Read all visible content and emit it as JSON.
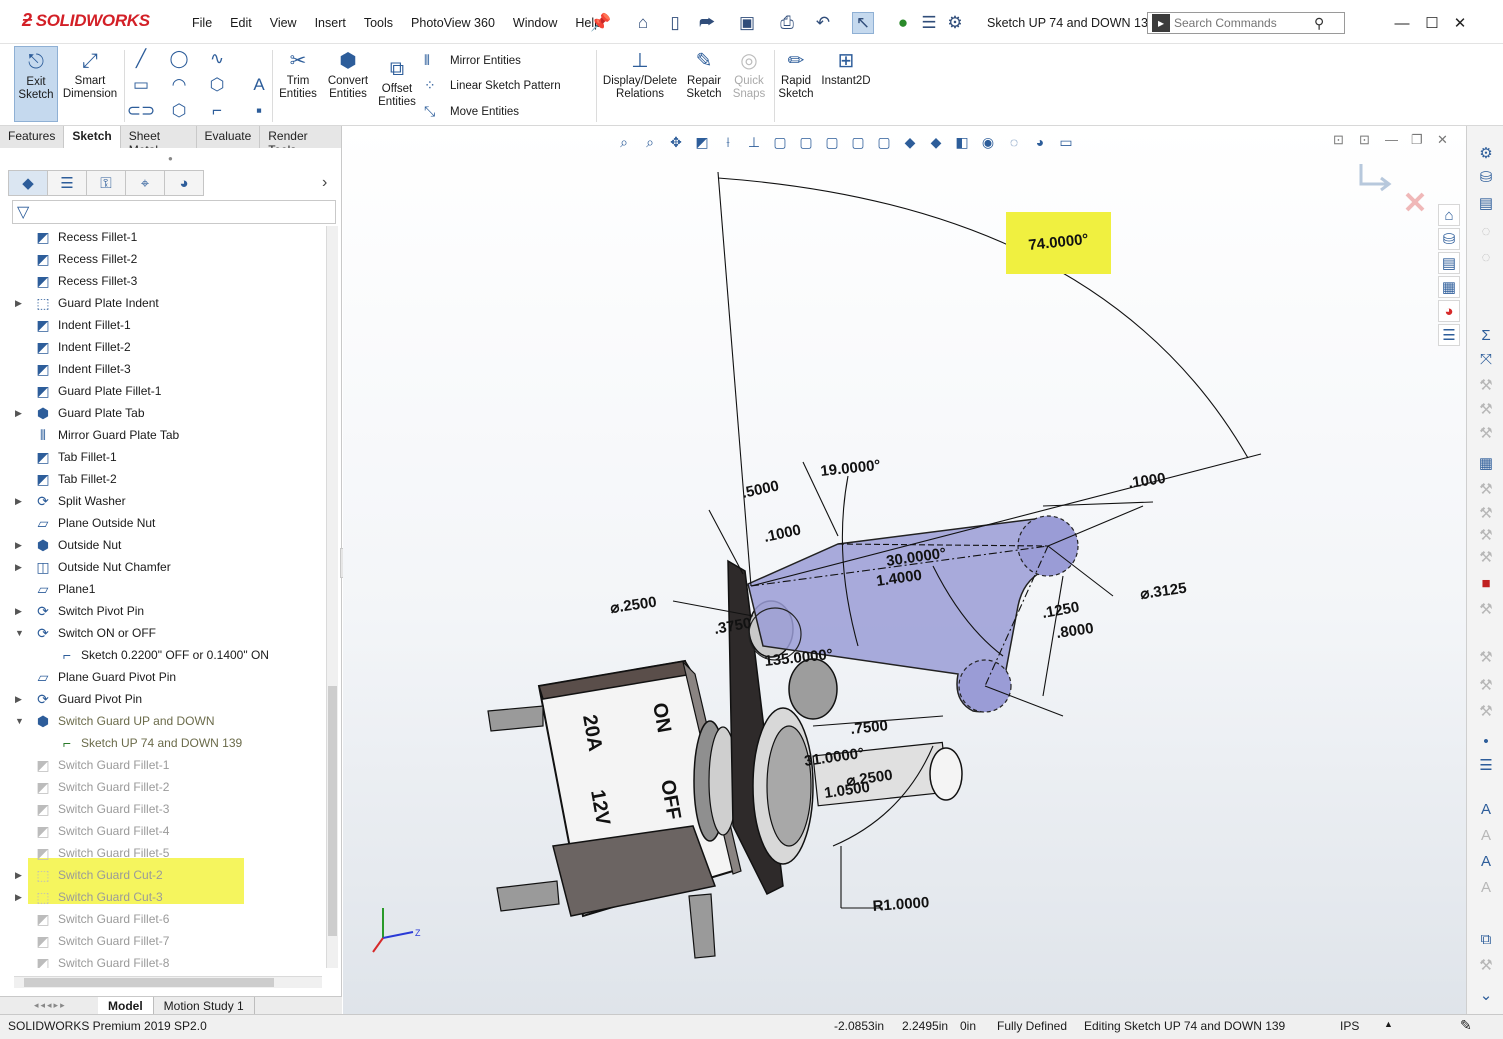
{
  "app": {
    "logo": "SOLIDWORKS",
    "menu": [
      "File",
      "Edit",
      "View",
      "Insert",
      "Tools",
      "PhotoView 360",
      "Window",
      "Help"
    ],
    "document_title": "Sketch UP 74 and DOWN 13...",
    "search_placeholder": "Search Commands",
    "accent_color": "#d32027"
  },
  "commandmanager": {
    "exit_sketch": "Exit Sketch",
    "smart_dimension": "Smart Dimension",
    "trim_entities": "Trim Entities",
    "convert_entities": "Convert Entities",
    "offset_entities": "Offset Entities",
    "mirror_entities": "Mirror Entities",
    "linear_sketch_pattern": "Linear Sketch Pattern",
    "move_entities": "Move Entities",
    "display_delete_relations": "Display/Delete Relations",
    "repair_sketch": "Repair Sketch",
    "quick_snaps": "Quick Snaps",
    "rapid_sketch": "Rapid Sketch",
    "instant2d": "Instant2D"
  },
  "tabs": [
    {
      "label": "Features",
      "active": false
    },
    {
      "label": "Sketch",
      "active": true
    },
    {
      "label": "Sheet Metal",
      "active": false
    },
    {
      "label": "Evaluate",
      "active": false
    },
    {
      "label": "Render Tools",
      "active": false
    }
  ],
  "tree": [
    {
      "label": "Recess Fillet-1",
      "icon": "fillet-icon",
      "state": "normal",
      "expandable": false
    },
    {
      "label": "Recess Fillet-2",
      "icon": "fillet-icon",
      "state": "normal",
      "expandable": false
    },
    {
      "label": "Recess Fillet-3",
      "icon": "fillet-icon",
      "state": "normal",
      "expandable": false
    },
    {
      "label": "Guard Plate Indent",
      "icon": "cut-extrude-icon",
      "state": "normal",
      "expandable": true
    },
    {
      "label": "Indent Fillet-1",
      "icon": "fillet-icon",
      "state": "normal",
      "expandable": false
    },
    {
      "label": "Indent Fillet-2",
      "icon": "fillet-icon",
      "state": "normal",
      "expandable": false
    },
    {
      "label": "Indent Fillet-3",
      "icon": "fillet-icon",
      "state": "normal",
      "expandable": false
    },
    {
      "label": "Guard Plate Fillet-1",
      "icon": "fillet-icon",
      "state": "normal",
      "expandable": false
    },
    {
      "label": "Guard Plate Tab",
      "icon": "boss-extrude-icon",
      "state": "normal",
      "expandable": true
    },
    {
      "label": "Mirror Guard Plate Tab",
      "icon": "mirror-icon",
      "state": "normal",
      "expandable": false
    },
    {
      "label": "Tab Fillet-1",
      "icon": "fillet-icon",
      "state": "normal",
      "expandable": false
    },
    {
      "label": "Tab Fillet-2",
      "icon": "fillet-icon",
      "state": "normal",
      "expandable": false
    },
    {
      "label": "Split Washer",
      "icon": "revolve-icon",
      "state": "normal",
      "expandable": true
    },
    {
      "label": "Plane Outside Nut",
      "icon": "plane-icon",
      "state": "normal",
      "expandable": false
    },
    {
      "label": "Outside Nut",
      "icon": "boss-extrude-icon",
      "state": "normal",
      "expandable": true
    },
    {
      "label": "Outside Nut Chamfer",
      "icon": "cut-revolve-icon",
      "state": "normal",
      "expandable": true
    },
    {
      "label": "Plane1",
      "icon": "plane-icon",
      "state": "normal",
      "expandable": false
    },
    {
      "label": "Switch Pivot Pin",
      "icon": "revolve-icon",
      "state": "normal",
      "expandable": true
    },
    {
      "label": "Switch ON or OFF",
      "icon": "revolve-icon",
      "state": "normal",
      "expandable": true,
      "expanded": true
    },
    {
      "label": "Sketch 0.2200\" OFF or  0.1400\" ON",
      "icon": "sketch-icon",
      "state": "child",
      "expandable": false
    },
    {
      "label": "Plane Guard Pivot Pin",
      "icon": "plane-icon",
      "state": "normal",
      "expandable": false
    },
    {
      "label": "Guard Pivot Pin",
      "icon": "revolve-icon",
      "state": "normal",
      "expandable": true
    },
    {
      "label": "Switch Guard UP and DOWN",
      "icon": "boss-extrude-icon",
      "state": "highlight",
      "expandable": true,
      "expanded": true
    },
    {
      "label": "Sketch UP 74 and DOWN 139",
      "icon": "sketch-icon",
      "state": "child-highlight",
      "expandable": false
    },
    {
      "label": "Switch Guard Fillet-1",
      "icon": "fillet-icon",
      "state": "suppressed",
      "expandable": false
    },
    {
      "label": "Switch Guard Fillet-2",
      "icon": "fillet-icon",
      "state": "suppressed",
      "expandable": false
    },
    {
      "label": "Switch Guard Fillet-3",
      "icon": "fillet-icon",
      "state": "suppressed",
      "expandable": false
    },
    {
      "label": "Switch Guard Fillet-4",
      "icon": "fillet-icon",
      "state": "suppressed",
      "expandable": false
    },
    {
      "label": "Switch Guard Fillet-5",
      "icon": "fillet-icon",
      "state": "suppressed",
      "expandable": false
    },
    {
      "label": "Switch Guard Cut-2",
      "icon": "cut-extrude-icon",
      "state": "suppressed",
      "expandable": true
    },
    {
      "label": "Switch Guard Cut-3",
      "icon": "cut-extrude-icon",
      "state": "suppressed",
      "expandable": true
    },
    {
      "label": "Switch Guard Fillet-6",
      "icon": "fillet-icon",
      "state": "suppressed",
      "expandable": false
    },
    {
      "label": "Switch Guard Fillet-7",
      "icon": "fillet-icon",
      "state": "suppressed",
      "expandable": false
    },
    {
      "label": "Switch Guard Fillet-8",
      "icon": "fillet-icon",
      "state": "suppressed",
      "expandable": false
    }
  ],
  "model_tabs": [
    {
      "label": "Model",
      "active": true
    },
    {
      "label": "Motion Study 1",
      "active": false
    }
  ],
  "statusbar": {
    "product": "SOLIDWORKS Premium 2019 SP2.0",
    "x": "-2.0853in",
    "y": "2.2495in",
    "z": "0in",
    "sketch_state": "Fully Defined",
    "editing": "Editing Sketch UP 74 and DOWN 139",
    "units": "IPS"
  },
  "viewport": {
    "dimensions": {
      "angle_up": "74.0000°",
      "angle_19": "19.0000°",
      "angle_30": "30.0000°",
      "d_0500": ".5000",
      "d_1000a": ".1000",
      "d_1000b": ".1000",
      "d_14000": "1.4000",
      "d_dia2500": "⌀.2500",
      "d_dia3125": "⌀.3125",
      "d_3750": ".3750",
      "d_1250": ".1250",
      "d_8000": ".8000",
      "d_7500": ".7500",
      "d_dia2500b": "⌀.2500",
      "d_31000": "31.0000°",
      "d_10500": "1.0500",
      "d_R1": "R1.0000",
      "d_overlap": "135.0000°"
    },
    "switch_labels": {
      "on": "ON",
      "off": "OFF",
      "amps": "20A",
      "volts": "12V"
    },
    "highlight_color": "#f0f040",
    "sketch_fill": "#9a9cd6"
  }
}
